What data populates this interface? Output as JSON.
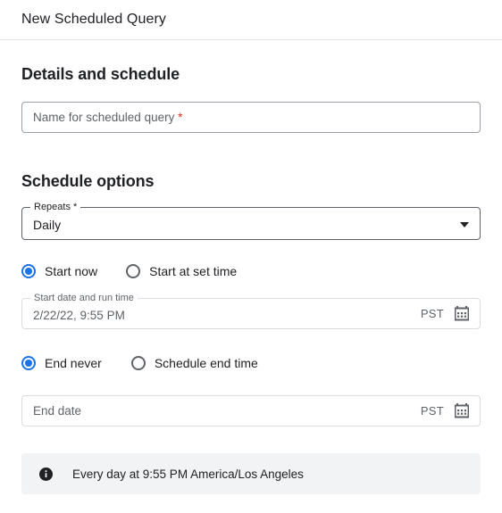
{
  "header": {
    "title": "New Scheduled Query"
  },
  "details_section": {
    "heading": "Details and schedule",
    "name_field": {
      "placeholder": "Name for scheduled query",
      "required_marker": "*",
      "value": ""
    }
  },
  "schedule_section": {
    "heading": "Schedule options",
    "repeats": {
      "label": "Repeats *",
      "value": "Daily",
      "icon": "chevron-down-icon"
    },
    "start_radios": {
      "options": [
        {
          "label": "Start now",
          "selected": true
        },
        {
          "label": "Start at set time",
          "selected": false
        }
      ]
    },
    "start_date_field": {
      "label": "Start date and run time",
      "value": "2/22/22, 9:55 PM",
      "timezone": "PST",
      "icon": "calendar-icon"
    },
    "end_radios": {
      "options": [
        {
          "label": "End never",
          "selected": true
        },
        {
          "label": "Schedule end time",
          "selected": false
        }
      ]
    },
    "end_date_field": {
      "placeholder": "End date",
      "value": "",
      "timezone": "PST",
      "icon": "calendar-icon"
    }
  },
  "info_banner": {
    "icon": "info-icon",
    "text": "Every day at 9:55 PM America/Los Angeles"
  },
  "colors": {
    "accent": "#1a73e8",
    "required": "#d93025",
    "banner_bg": "#f1f3f4",
    "text_primary": "#202124",
    "text_secondary": "#5f6368",
    "border": "#9aa0a6"
  }
}
